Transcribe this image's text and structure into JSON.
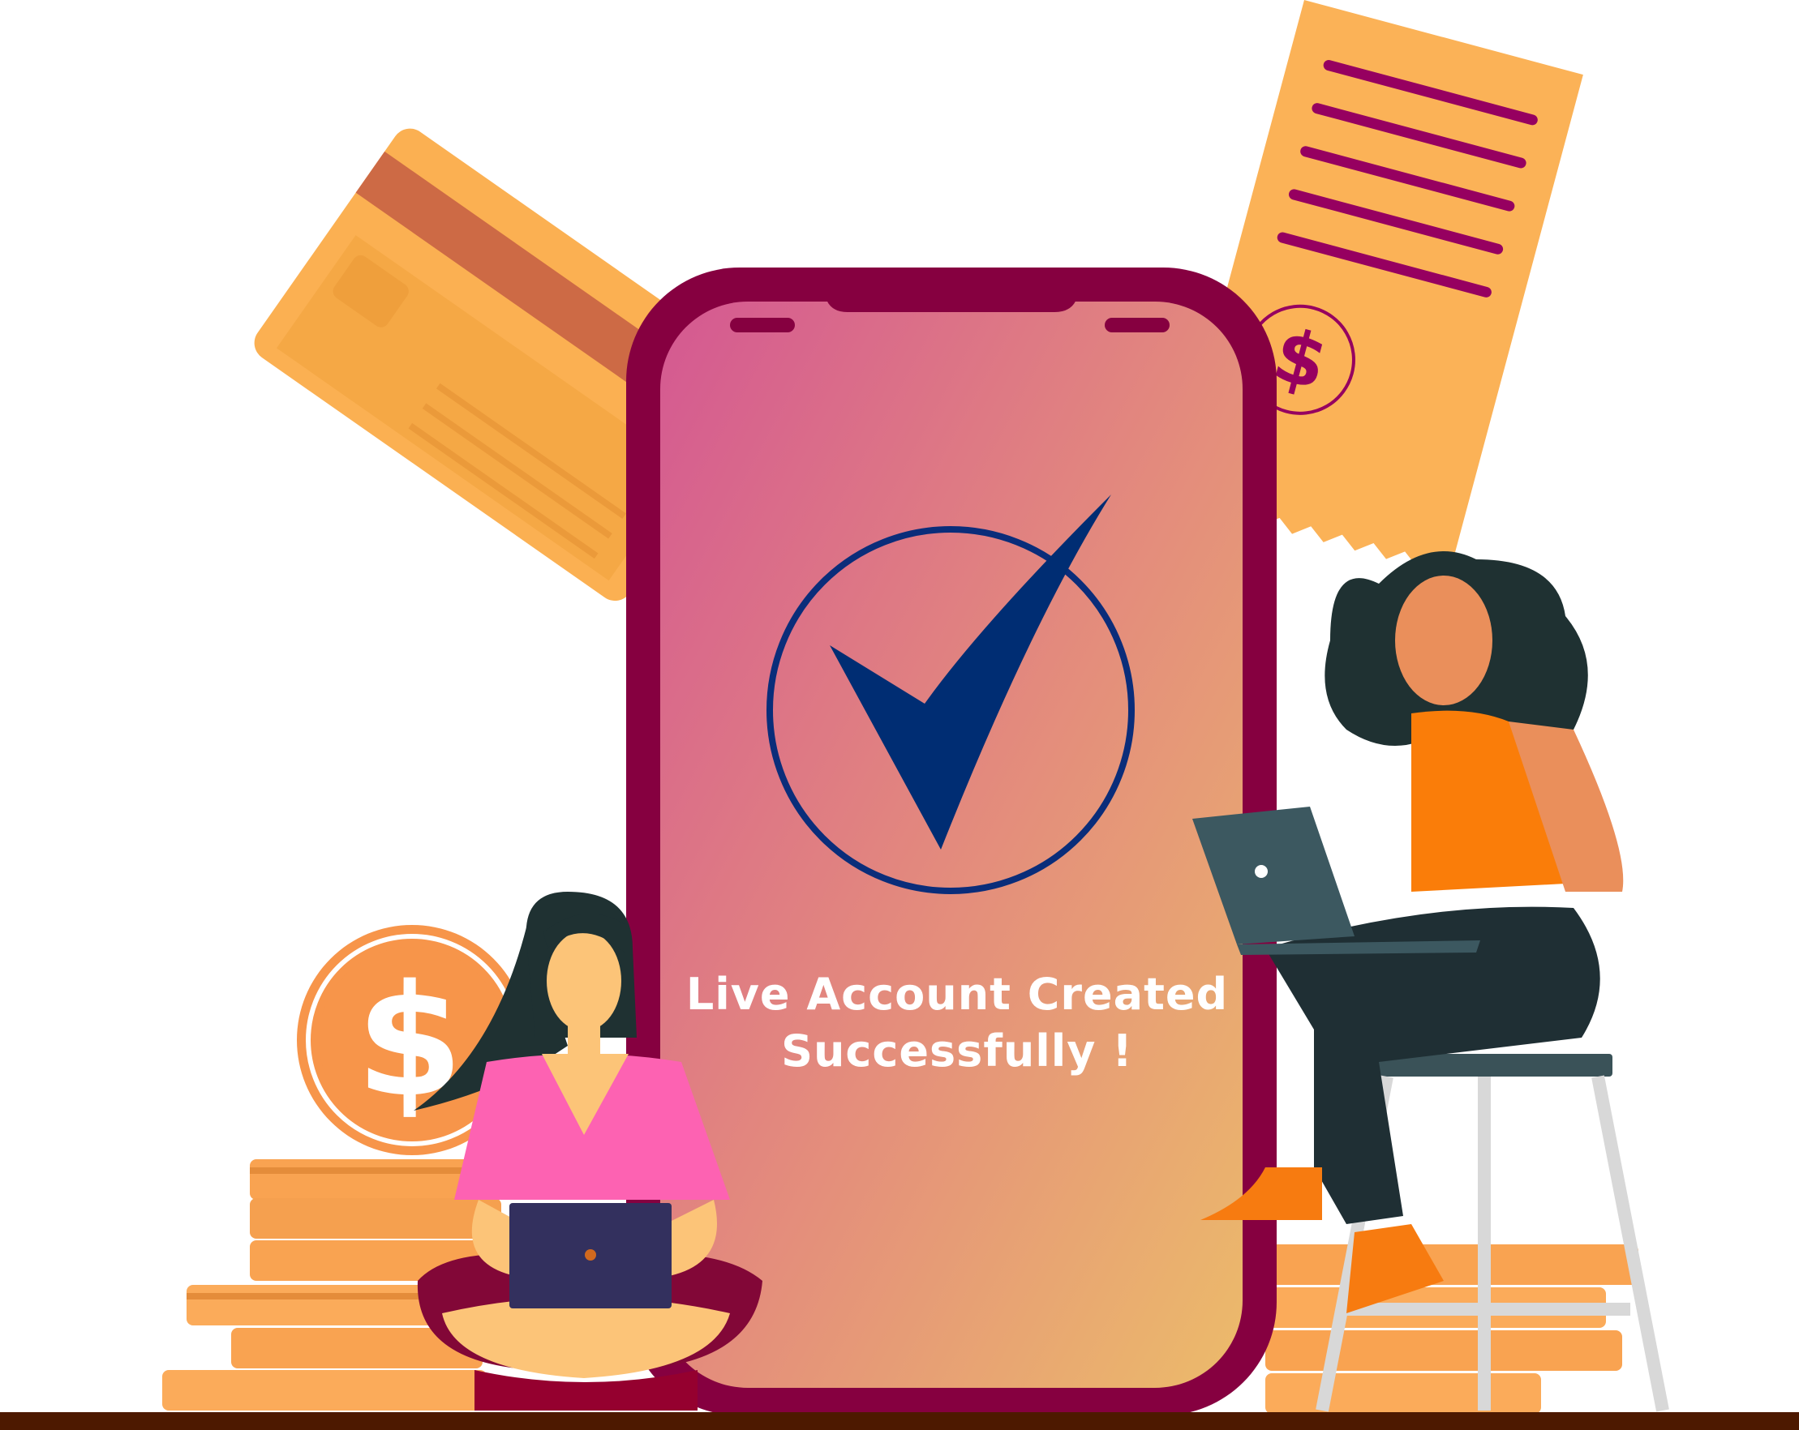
{
  "success_message": {
    "line1": "Live Account Created",
    "line2": "Successfully !"
  },
  "icons": {
    "check": "checkmark-icon",
    "coin": "dollar-coin-icon",
    "receipt": "receipt-icon",
    "card": "credit-card-icon"
  },
  "colors": {
    "phone_frame": "#860040",
    "check": "#002d73",
    "accent_orange": "#fbb257",
    "receipt_lines": "#960060"
  }
}
